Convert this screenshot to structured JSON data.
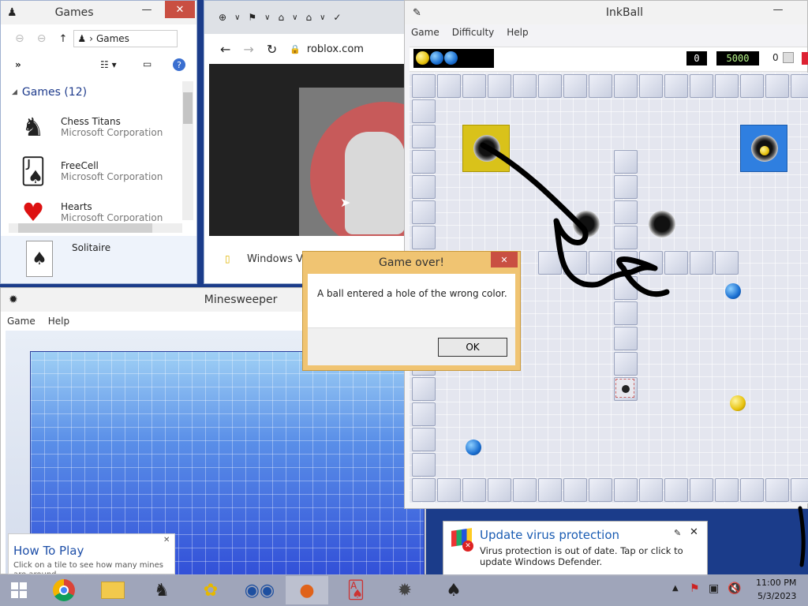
{
  "explorer": {
    "title": "Games",
    "breadcrumb": "Games",
    "group_header": "Games (12)",
    "items": [
      {
        "name": "Chess Titans",
        "publisher": "Microsoft Corporation",
        "icon": "chess-icon"
      },
      {
        "name": "FreeCell",
        "publisher": "Microsoft Corporation",
        "icon": "freecell-icon"
      },
      {
        "name": "Hearts",
        "publisher": "Microsoft Corporation",
        "icon": "hearts-icon"
      }
    ],
    "selected_item": "Solitaire"
  },
  "browser": {
    "url": "roblox.com",
    "bottom_text": "Windows Vis"
  },
  "minesweeper": {
    "title": "Minesweeper",
    "menu": [
      "Game",
      "Help"
    ]
  },
  "inkball": {
    "title": "InkBall",
    "menu": [
      "Game",
      "Difficulty",
      "Help"
    ],
    "score_left": "0",
    "score_main": "5000",
    "score_right": "0"
  },
  "dialog": {
    "title": "Game over!",
    "message": "A ball entered a hole of the wrong color.",
    "ok_label": "OK",
    "close_label": "✕"
  },
  "howto": {
    "title": "How To Play",
    "text": "Click on a tile to see how many mines are around"
  },
  "notification": {
    "title": "Update virus protection",
    "text": "Virus protection is out of date. Tap or click to update Windows Defender."
  },
  "clock": {
    "time": "11:00 PM",
    "date": "5/3/2023"
  },
  "colors": {
    "accent": "#f0c472",
    "notif_title": "#1a5cb3",
    "yellow_hole": "#d9c21a",
    "blue_hole": "#2f7fe0"
  }
}
